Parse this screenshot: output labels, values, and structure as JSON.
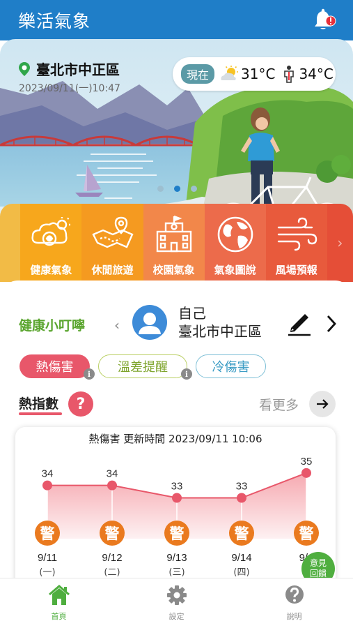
{
  "app": {
    "title": "樂活氣象"
  },
  "hero": {
    "location": "臺北市中正區",
    "datetime": "2023/09/11(一)10:47",
    "now_label": "現在",
    "temp": "31°C",
    "feels_temp": "34°C",
    "carousel": {
      "count": 3,
      "active": 1
    }
  },
  "categories": [
    {
      "label": "健康氣象",
      "color": "#f7a71c",
      "icon": "health-icon"
    },
    {
      "label": "休閒旅遊",
      "color": "#f59a20",
      "icon": "travel-map-icon"
    },
    {
      "label": "校園氣象",
      "color": "#f2874a",
      "icon": "school-icon"
    },
    {
      "label": "氣象圖說",
      "color": "#ec6b4b",
      "icon": "globe-icon"
    },
    {
      "label": "風場預報",
      "color": "#e85a3c",
      "icon": "wind-icon"
    }
  ],
  "health": {
    "title": "健康小叮嚀",
    "user_name": "自己",
    "user_location": "臺北市中正區",
    "tags": [
      "熱傷害",
      "溫差提醒",
      "冷傷害"
    ],
    "index_title": "熱指數",
    "help": "?",
    "more": "看更多"
  },
  "chart_data": {
    "type": "area",
    "title": "熱傷害 更新時間 2023/09/11 10:06",
    "x": [
      "9/11",
      "9/12",
      "9/13",
      "9/14",
      "9/1"
    ],
    "weekdays": [
      "(一)",
      "(二)",
      "(三)",
      "(四)",
      "("
    ],
    "values": [
      34,
      34,
      33,
      33,
      35
    ],
    "level_labels": [
      "警",
      "警",
      "警",
      "警",
      "警"
    ],
    "ylim": [
      30,
      36
    ],
    "colors": {
      "line": "#e8576a",
      "fill_top": "#f5a0a8",
      "badge": "#ea7a1f"
    }
  },
  "feedback": {
    "line1": "意見",
    "line2": "回饋"
  },
  "nav": [
    {
      "label": "首頁",
      "active": true
    },
    {
      "label": "設定",
      "active": false
    },
    {
      "label": "說明",
      "active": false
    }
  ],
  "colors": {
    "primary": "#1f7ec8",
    "green": "#5aa52e",
    "accent": "#e8576a"
  }
}
